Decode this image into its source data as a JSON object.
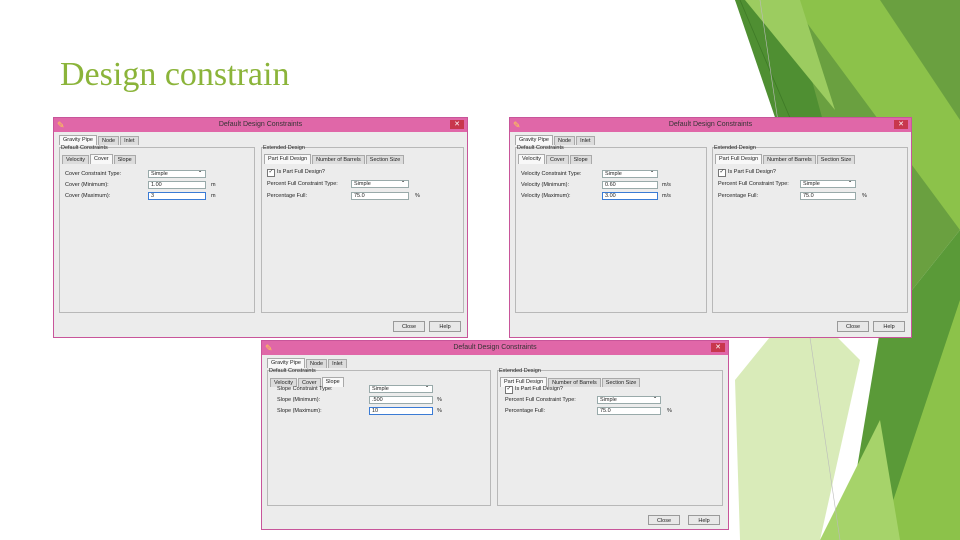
{
  "slide": {
    "title": "Design constrain"
  },
  "dialogs": [
    {
      "title": "Default Design Constraints",
      "tabs": [
        "Gravity Pipe",
        "Node",
        "Inlet"
      ],
      "default_label": "Default Constraints",
      "sub_tabs": [
        "Velocity",
        "Cover",
        "Slope"
      ],
      "sub_active": 1,
      "rows": [
        {
          "label": "Cover Constraint Type:",
          "value": "Simple",
          "unit": ""
        },
        {
          "label": "Cover (Minimum):",
          "value": "1.00",
          "unit": "m"
        },
        {
          "label": "Cover (Maximum):",
          "value": "3",
          "unit": "m"
        }
      ],
      "ext_label": "Extended Design",
      "ext_tabs": [
        "Part Full Design",
        "Number of Barrels",
        "Section Size"
      ],
      "ext_check": "Is Part Full Design?",
      "ext_rows": [
        {
          "label": "Percent Full Constraint Type:",
          "value": "Simple",
          "unit": ""
        },
        {
          "label": "Percentage Full:",
          "value": "75.0",
          "unit": "%"
        }
      ],
      "close_label": "Close",
      "help_label": "Help"
    },
    {
      "title": "Default Design Constraints",
      "tabs": [
        "Gravity Pipe",
        "Node",
        "Inlet"
      ],
      "default_label": "Default Constraints",
      "sub_tabs": [
        "Velocity",
        "Cover",
        "Slope"
      ],
      "sub_active": 0,
      "rows": [
        {
          "label": "Velocity Constraint Type:",
          "value": "Simple",
          "unit": ""
        },
        {
          "label": "Velocity (Minimum):",
          "value": "0.60",
          "unit": "m/s"
        },
        {
          "label": "Velocity (Maximum):",
          "value": "3.00",
          "unit": "m/s"
        }
      ],
      "ext_label": "Extended Design",
      "ext_tabs": [
        "Part Full Design",
        "Number of Barrels",
        "Section Size"
      ],
      "ext_check": "Is Part Full Design?",
      "ext_rows": [
        {
          "label": "Percent Full Constraint Type:",
          "value": "Simple",
          "unit": ""
        },
        {
          "label": "Percentage Full:",
          "value": "75.0",
          "unit": "%"
        }
      ],
      "close_label": "Close",
      "help_label": "Help"
    },
    {
      "title": "Default Design Constraints",
      "tabs": [
        "Gravity Pipe",
        "Node",
        "Inlet"
      ],
      "default_label": "Default Constraints",
      "sub_tabs": [
        "Velocity",
        "Cover",
        "Slope"
      ],
      "sub_active": 2,
      "rows": [
        {
          "label": "Slope Constraint Type:",
          "value": "Simple",
          "unit": ""
        },
        {
          "label": "Slope (Minimum):",
          "value": ".500",
          "unit": "%"
        },
        {
          "label": "Slope (Maximum):",
          "value": "10",
          "unit": "%"
        }
      ],
      "ext_label": "Extended Design",
      "ext_tabs": [
        "Part Full Design",
        "Number of Barrels",
        "Section Size"
      ],
      "ext_check": "Is Part Full Design?",
      "ext_rows": [
        {
          "label": "Percent Full Constraint Type:",
          "value": "Simple",
          "unit": ""
        },
        {
          "label": "Percentage Full:",
          "value": "75.0",
          "unit": "%"
        }
      ],
      "close_label": "Close",
      "help_label": "Help"
    }
  ],
  "colors": {
    "title_green": "#8bb43a",
    "dialog_titlebar": "#e067a8",
    "close_red": "#c8374d"
  },
  "icons": {
    "titlebar": "pencil-icon",
    "close": "close-icon",
    "checkbox": "checkbox-icon"
  }
}
